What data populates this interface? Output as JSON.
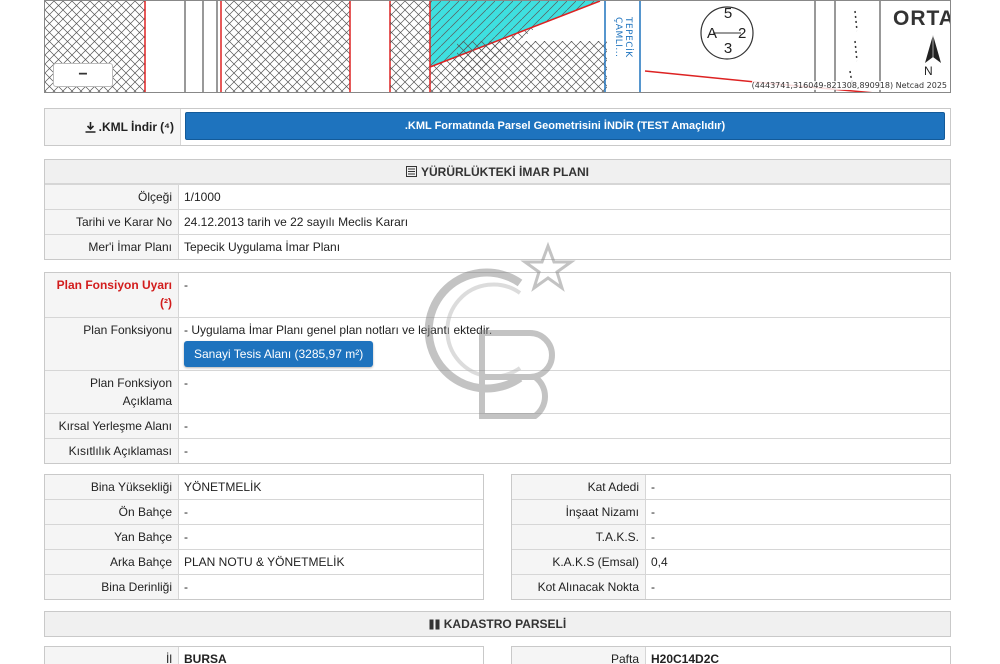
{
  "map": {
    "attribution": "(4443741,316049-821308,890918) Netcad 2025",
    "street_label": "TEPECİK ÇAMLI...",
    "place_label": "ORTA",
    "parcel_code": {
      "top": "5",
      "letter": "A",
      "right": "2",
      "bottom": "3"
    },
    "north_label": "N",
    "zoom_label": "−"
  },
  "kml": {
    "label": ".KML İndir",
    "note": "(⁴)",
    "button": ".KML Formatında Parsel Geometrisini İNDİR (TEST Amaçlıdır)"
  },
  "imar": {
    "title": "YÜRÜRLÜKTEKİ İMAR PLANI",
    "rows": [
      {
        "label": "Ölçeği",
        "value": "1/1000"
      },
      {
        "label": "Tarihi ve Karar No",
        "value": "24.12.2013 tarih ve 22 sayılı Meclis Kararı"
      },
      {
        "label": "Mer'i İmar Planı",
        "value": "Tepecik Uygulama İmar Planı"
      }
    ]
  },
  "fonksiyon": {
    "warning_label": "Plan Fonsiyon Uyarı",
    "warning_note": "(²)",
    "warning_value": "-",
    "function_label": "Plan Fonksiyonu",
    "function_text": "- Uygulama İmar Planı genel plan notları ve lejantı ektedir.",
    "function_button": "Sanayi Tesis Alanı (3285,97 m²)",
    "desc_label": "Plan Fonksiyon Açıklama",
    "desc_value": "-",
    "rural_label": "Kırsal Yerleşme Alanı",
    "rural_value": "-",
    "restriction_label": "Kısıtlılık Açıklaması",
    "restriction_value": "-"
  },
  "yapi_left": [
    {
      "label": "Bina Yüksekliği",
      "value": "YÖNETMELİK"
    },
    {
      "label": "Ön Bahçe",
      "value": "-"
    },
    {
      "label": "Yan Bahçe",
      "value": "-"
    },
    {
      "label": "Arka Bahçe",
      "value": "PLAN NOTU & YÖNETMELİK"
    },
    {
      "label": "Bina Derinliği",
      "value": "-"
    }
  ],
  "yapi_right": [
    {
      "label": "Kat Adedi",
      "value": "-"
    },
    {
      "label": "İnşaat Nizamı",
      "value": "-"
    },
    {
      "label": "T.A.K.S.",
      "value": "-"
    },
    {
      "label": "K.A.K.S (Emsal)",
      "value": "0,4"
    },
    {
      "label": "Kot Alınacak Nokta",
      "value": "-"
    }
  ],
  "kadastro": {
    "title": "KADASTRO PARSELİ",
    "il_label": "İl",
    "il_value": "BURSA",
    "pafta_label": "Pafta",
    "pafta_value": "H20C14D2C"
  }
}
